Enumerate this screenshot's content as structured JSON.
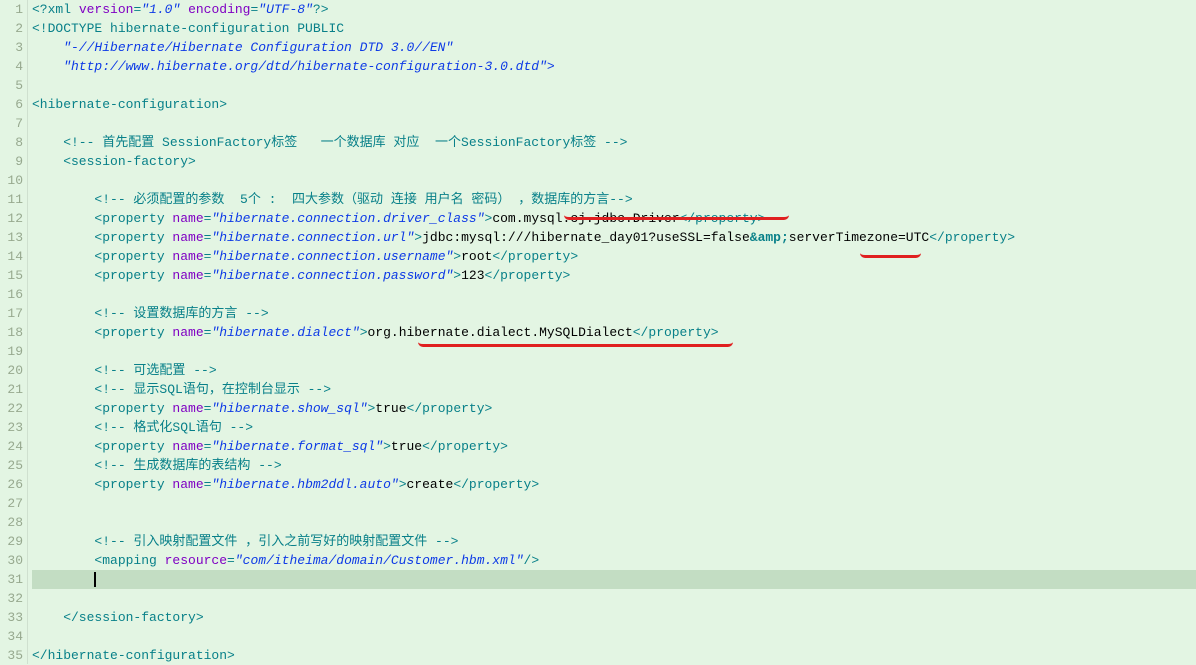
{
  "linenums": [
    "1",
    "2",
    "3",
    "4",
    "5",
    "6",
    "7",
    "8",
    "9",
    "10",
    "11",
    "12",
    "13",
    "14",
    "15",
    "16",
    "17",
    "18",
    "19",
    "20",
    "21",
    "22",
    "23",
    "24",
    "25",
    "26",
    "27",
    "28",
    "29",
    "30",
    "31",
    "32",
    "33",
    "34",
    "35"
  ],
  "xml": {
    "decl_open": "<?xml",
    "version_attr": " version",
    "version_val": "\"1.0\"",
    "encoding_attr": " encoding",
    "encoding_val": "\"UTF-8\"",
    "decl_close": "?>"
  },
  "doctype": {
    "open": "<!DOCTYPE",
    "rest1": " hibernate-configuration PUBLIC",
    "line3": "    \"-//Hibernate/Hibernate Configuration DTD 3.0//EN\"",
    "line4": "    \"http://www.hibernate.org/dtd/hibernate-configuration-3.0.dtd\">"
  },
  "l6_open": "<hibernate-configuration>",
  "l8_comment": "    <!-- 首先配置 SessionFactory标签   一个数据库 对应  一个SessionFactory标签 -->",
  "l9_open": "    <session-factory>",
  "l11_comment": "        <!-- 必须配置的参数  5个 :  四大参数（驱动 连接 用户名 密码） ，数据库的方言-->",
  "tags": {
    "prop_open": "        <property",
    "name_attr": " name",
    "gt": ">",
    "prop_close": "</property>"
  },
  "p12": {
    "name": "\"hibernate.connection.driver_class\"",
    "val": "com.mysql.cj.jdbc.Driver"
  },
  "p13": {
    "name": "\"hibernate.connection.url\"",
    "val_pre": "jdbc:mysql:///hibernate_day01?useSSL=false",
    "amp": "&amp;",
    "val_post": "serverTimezone=UTC"
  },
  "p14": {
    "name": "\"hibernate.connection.username\"",
    "val": "root"
  },
  "p15": {
    "name": "\"hibernate.connection.password\"",
    "val": "123"
  },
  "l17_comment": "        <!-- 设置数据库的方言 -->",
  "p18": {
    "name": "\"hibernate.dialect\"",
    "val": "org.hibernate.dialect.MySQLDialect"
  },
  "l20_comment": "        <!-- 可选配置 -->",
  "l21_comment": "        <!-- 显示SQL语句，在控制台显示 -->",
  "p22": {
    "name": "\"hibernate.show_sql\"",
    "val": "true"
  },
  "l23_comment": "        <!-- 格式化SQL语句 -->",
  "p24": {
    "name": "\"hibernate.format_sql\"",
    "val": "true"
  },
  "l25_comment": "        <!-- 生成数据库的表结构 -->",
  "p26": {
    "name": "\"hibernate.hbm2ddl.auto\"",
    "val": "create"
  },
  "l29_comment": "        <!-- 引入映射配置文件 ，引入之前写好的映射配置文件 -->",
  "mapping": {
    "open": "        <mapping",
    "attr": " resource",
    "val": "\"com/itheima/domain/Customer.hbm.xml\"",
    "close": "/>"
  },
  "indent31": "        ",
  "l33_close": "    </session-factory>",
  "l35_close": "</hibernate-configuration>"
}
